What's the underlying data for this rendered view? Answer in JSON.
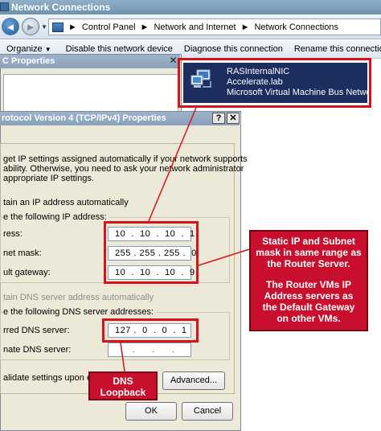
{
  "window": {
    "title": "Network Connections"
  },
  "address_bar": {
    "crumbs": [
      "Control Panel",
      "Network and Internet",
      "Network Connections"
    ],
    "separator": "►"
  },
  "command_bar": {
    "items": [
      {
        "label": "Organize",
        "dropdown": true
      },
      {
        "label": "Disable this network device"
      },
      {
        "label": "Diagnose this connection"
      },
      {
        "label": "Rename this connection"
      }
    ]
  },
  "properties_window": {
    "title": "C Properties",
    "close": "✕"
  },
  "ipv4_dialog": {
    "title": "rotocol Version 4 (TCP/IPv4) Properties",
    "help": "?",
    "close": "✕",
    "intro_lines": [
      "get IP settings assigned automatically if your network supports",
      "ability. Otherwise, you need to ask your network administrator",
      "appropriate IP settings."
    ],
    "obtain_ip_auto": "tain an IP address automatically",
    "use_ip_label": "e the following IP address:",
    "ip_label": "ress:",
    "subnet_label": "net mask:",
    "gateway_label": "ult gateway:",
    "ip_value": "10  .  10  .  10  .  1",
    "subnet_value": "255 . 255 . 255 .  0",
    "gateway_value": "10  .  10  .  10  .  9",
    "obtain_dns_auto": "tain DNS server address automatically",
    "use_dns_label": "e the following DNS server addresses:",
    "preferred_dns_label": "rred DNS server:",
    "alternate_dns_label": "nate DNS server:",
    "preferred_dns_value": "127 .  0  .  0  .  1",
    "alternate_dns_value": "      .      .      .",
    "validate_label": "alidate settings upon exit",
    "advanced_button": "Advanced...",
    "ok_button": "OK",
    "cancel_button": "Cancel"
  },
  "nic_card": {
    "name": "RASInternalNIC",
    "domain": "Accelerate.lab",
    "adapter": "Microsoft Virtual Machine Bus Networ..."
  },
  "annotations": {
    "static_ip_note_1": "Static IP and Subnet mask in same range as the Router Server.",
    "static_ip_note_2": "The Router VMs IP Address servers as the Default Gateway on other VMs.",
    "dns_note": "DNS Loopback",
    "highlight_color": "#d8121a",
    "callout_color": "#c8102e"
  }
}
